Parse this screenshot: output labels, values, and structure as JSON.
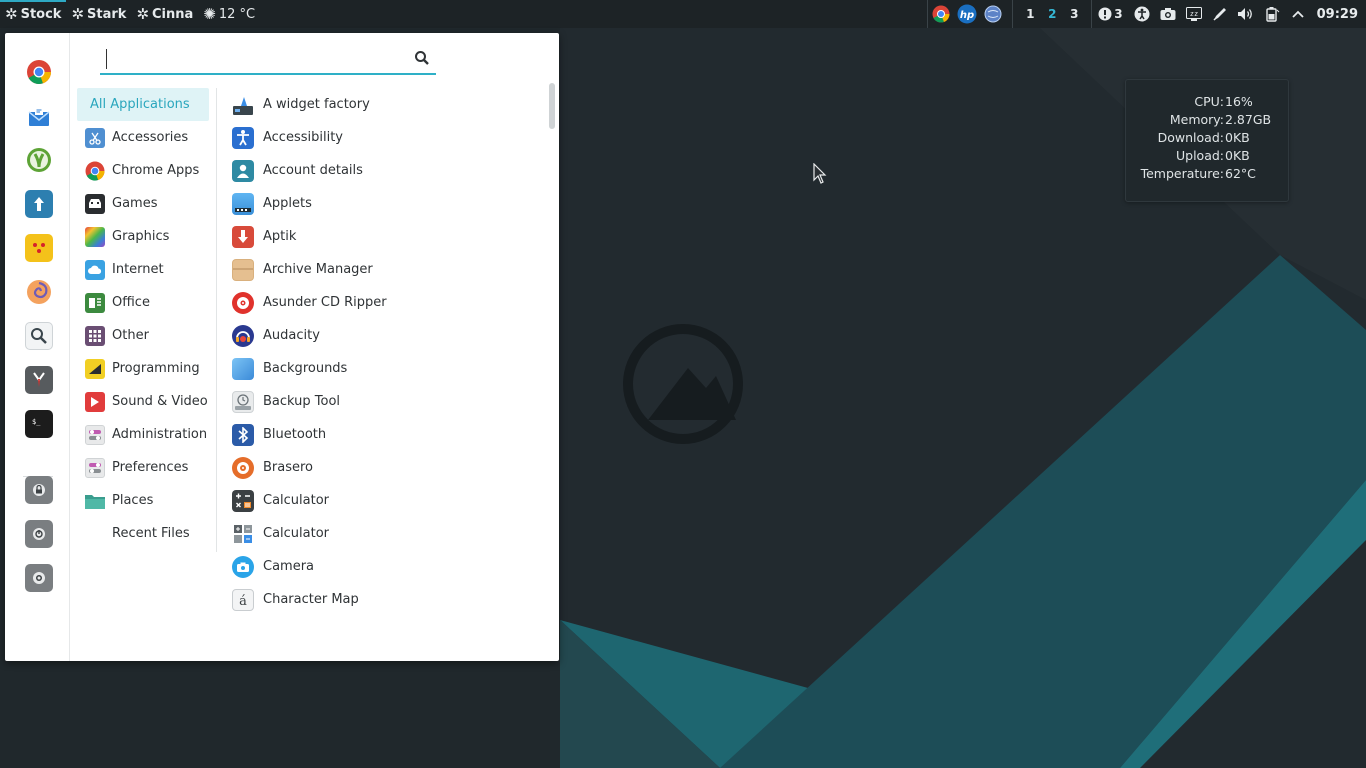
{
  "panel": {
    "launchers": [
      {
        "label": "Stock",
        "icon": "gear-icon"
      },
      {
        "label": "Stark",
        "icon": "gear-icon"
      },
      {
        "label": "Cinna",
        "icon": "gear-icon"
      }
    ],
    "weather": {
      "label": "12 °C",
      "icon": "sun-icon"
    },
    "tray_apps": [
      "chrome-icon",
      "hp-icon",
      "network-globe-icon"
    ],
    "workspaces": [
      "1",
      "2",
      "3"
    ],
    "current_workspace": "2",
    "notifications": {
      "count": "3",
      "icon": "alert-icon"
    },
    "status_icons": [
      "accessibility-icon",
      "screenshot-icon",
      "keyboard-icon",
      "pen-icon",
      "volume-icon",
      "battery-icon",
      "chevron-up-icon"
    ],
    "clock": "09:29"
  },
  "sysmon": {
    "rows": [
      {
        "label": "CPU:",
        "value": "16%"
      },
      {
        "label": "Memory:",
        "value": "2.87GB"
      },
      {
        "label": "Download:",
        "value": "0KB"
      },
      {
        "label": "Upload:",
        "value": "0KB"
      },
      {
        "label": "Temperature:",
        "value": "62°C"
      }
    ]
  },
  "menu": {
    "search": {
      "value": "",
      "placeholder": ""
    },
    "favorites": [
      "chrome-icon",
      "mail-icon",
      "cinnamon-icon",
      "updater-icon",
      "dice-icon",
      "swirl-icon",
      "magnifier-icon",
      "gimp-icon",
      "terminal-icon"
    ],
    "session": [
      "lock-icon",
      "logout-icon",
      "shutdown-icon"
    ],
    "categories": [
      {
        "label": "All Applications",
        "icon": "",
        "selected": true
      },
      {
        "label": "Accessories",
        "icon": "scissors-icon"
      },
      {
        "label": "Chrome Apps",
        "icon": "chrome-icon"
      },
      {
        "label": "Games",
        "icon": "gamepad-icon"
      },
      {
        "label": "Graphics",
        "icon": "palette-icon"
      },
      {
        "label": "Internet",
        "icon": "cloud-icon"
      },
      {
        "label": "Office",
        "icon": "office-icon"
      },
      {
        "label": "Other",
        "icon": "grid-icon"
      },
      {
        "label": "Programming",
        "icon": "ruler-icon"
      },
      {
        "label": "Sound & Video",
        "icon": "play-icon"
      },
      {
        "label": "Administration",
        "icon": "toggles-icon"
      },
      {
        "label": "Preferences",
        "icon": "toggles-icon"
      },
      {
        "label": "Places",
        "icon": "folder-icon"
      },
      {
        "label": "Recent Files",
        "icon": ""
      }
    ],
    "apps": [
      {
        "label": "A widget factory",
        "icon": "widget-icon"
      },
      {
        "label": "Accessibility",
        "icon": "accessibility-icon"
      },
      {
        "label": "Account details",
        "icon": "user-icon"
      },
      {
        "label": "Applets",
        "icon": "applets-icon"
      },
      {
        "label": "Aptik",
        "icon": "download-arrow-icon"
      },
      {
        "label": "Archive Manager",
        "icon": "archive-icon"
      },
      {
        "label": "Asunder CD Ripper",
        "icon": "cd-icon"
      },
      {
        "label": "Audacity",
        "icon": "headphones-icon"
      },
      {
        "label": "Backgrounds",
        "icon": "backgrounds-icon"
      },
      {
        "label": "Backup Tool",
        "icon": "backup-icon"
      },
      {
        "label": "Bluetooth",
        "icon": "bluetooth-icon"
      },
      {
        "label": "Brasero",
        "icon": "brasero-icon"
      },
      {
        "label": "Calculator",
        "icon": "calculator-icon"
      },
      {
        "label": "Calculator",
        "icon": "calculator-alt-icon"
      },
      {
        "label": "Camera",
        "icon": "camera-icon"
      },
      {
        "label": "Character Map",
        "icon": "charmap-icon"
      }
    ],
    "colors": {
      "accent": "#2eb0c7",
      "selected_bg": "#dff3f6"
    }
  }
}
